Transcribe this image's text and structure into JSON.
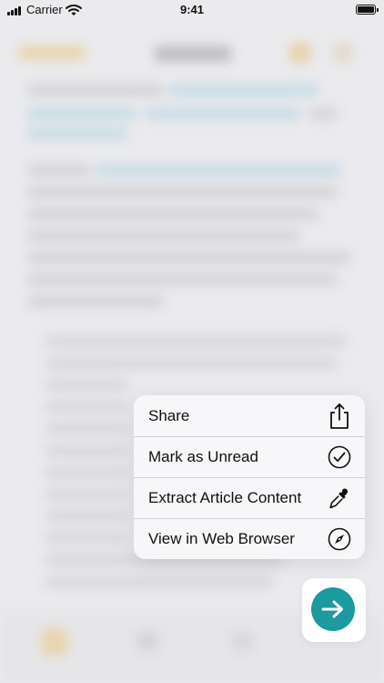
{
  "status_bar": {
    "carrier": "Carrier",
    "time": "9:41"
  },
  "context_menu": {
    "items": [
      {
        "label": "Share",
        "icon": "share-icon"
      },
      {
        "label": "Mark as Unread",
        "icon": "checkmark-circle-icon"
      },
      {
        "label": "Extract Article Content",
        "icon": "eyedropper-icon"
      },
      {
        "label": "View in Web Browser",
        "icon": "compass-icon"
      }
    ]
  },
  "fab": {
    "icon": "arrow-right-icon",
    "color": "#1c9aa0"
  },
  "colors": {
    "accent": "#1c9aa0",
    "menu_background": "#f7f7f9",
    "text": "#111111"
  }
}
